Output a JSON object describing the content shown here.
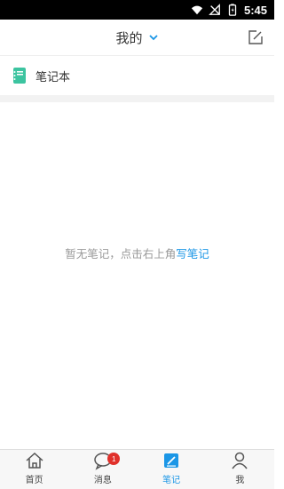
{
  "status_bar": {
    "time": "5:45"
  },
  "header": {
    "title": "我的"
  },
  "notebook": {
    "label": "笔记本"
  },
  "empty_state": {
    "prefix": "暂无笔记，点击右上角",
    "link": "写笔记"
  },
  "tabs": [
    {
      "label": "首页"
    },
    {
      "label": "消息",
      "badge": "1"
    },
    {
      "label": "笔记"
    },
    {
      "label": "我"
    }
  ],
  "colors": {
    "accent": "#1a96e6",
    "badge": "#e0302a",
    "notebook_icon": "#3cc4a0"
  }
}
